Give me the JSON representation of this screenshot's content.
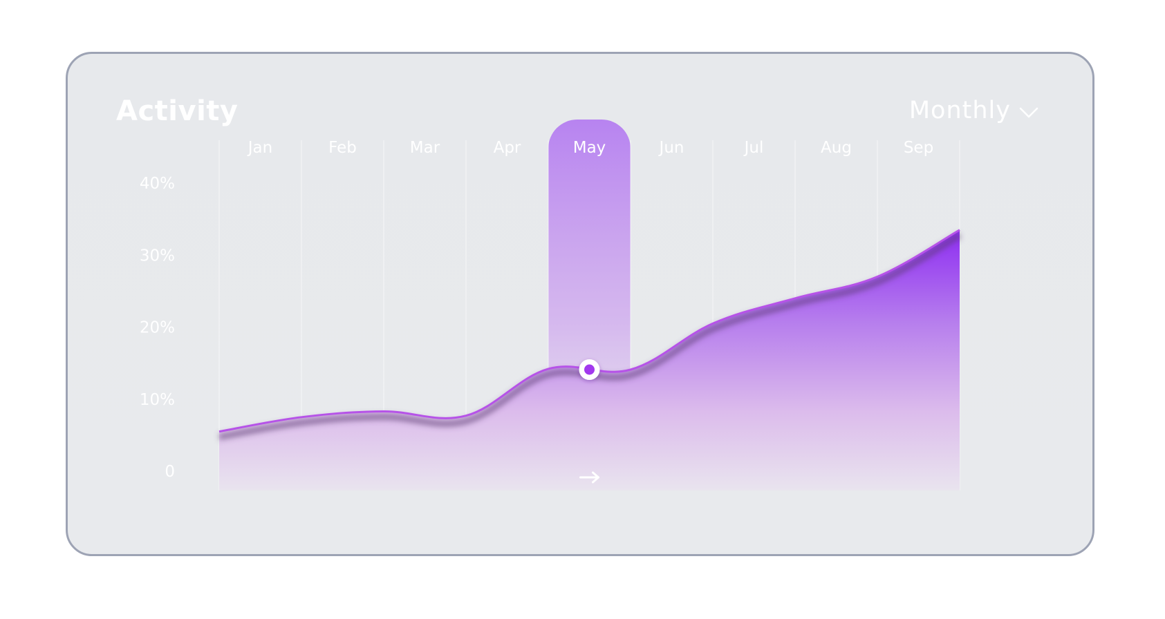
{
  "card": {
    "title": "Activity",
    "period_selector": {
      "value": "Monthly",
      "icon": "chevron-down-icon"
    },
    "highlight_nav_icon": "arrow-right-icon"
  },
  "colors": {
    "accent": "#8a2cf0",
    "accent_light": "#b785f0",
    "line": "#b653e8",
    "card_bg": "#e8eaed",
    "card_border": "#9da3b4",
    "text": "#ffffff"
  },
  "chart_data": {
    "type": "area",
    "categories": [
      "Jan",
      "Feb",
      "Mar",
      "Apr",
      "May",
      "Jun",
      "Jul",
      "Aug",
      "Sep"
    ],
    "y_ticks": [
      "0",
      "10%",
      "20%",
      "30%",
      "40%"
    ],
    "ylim": [
      0,
      40
    ],
    "series": [
      {
        "x": [
          "",
          "Jan",
          "Feb",
          "Mar",
          "Apr",
          "May",
          "Jun",
          "Jul",
          "Aug",
          "Sep"
        ],
        "values": [
          5.5,
          7.5,
          8.3,
          7.7,
          14.2,
          14.1,
          20.5,
          24.0,
          27.0,
          33.5
        ]
      }
    ],
    "highlighted_category": "May",
    "highlighted_value": 14.1,
    "grid": true
  }
}
